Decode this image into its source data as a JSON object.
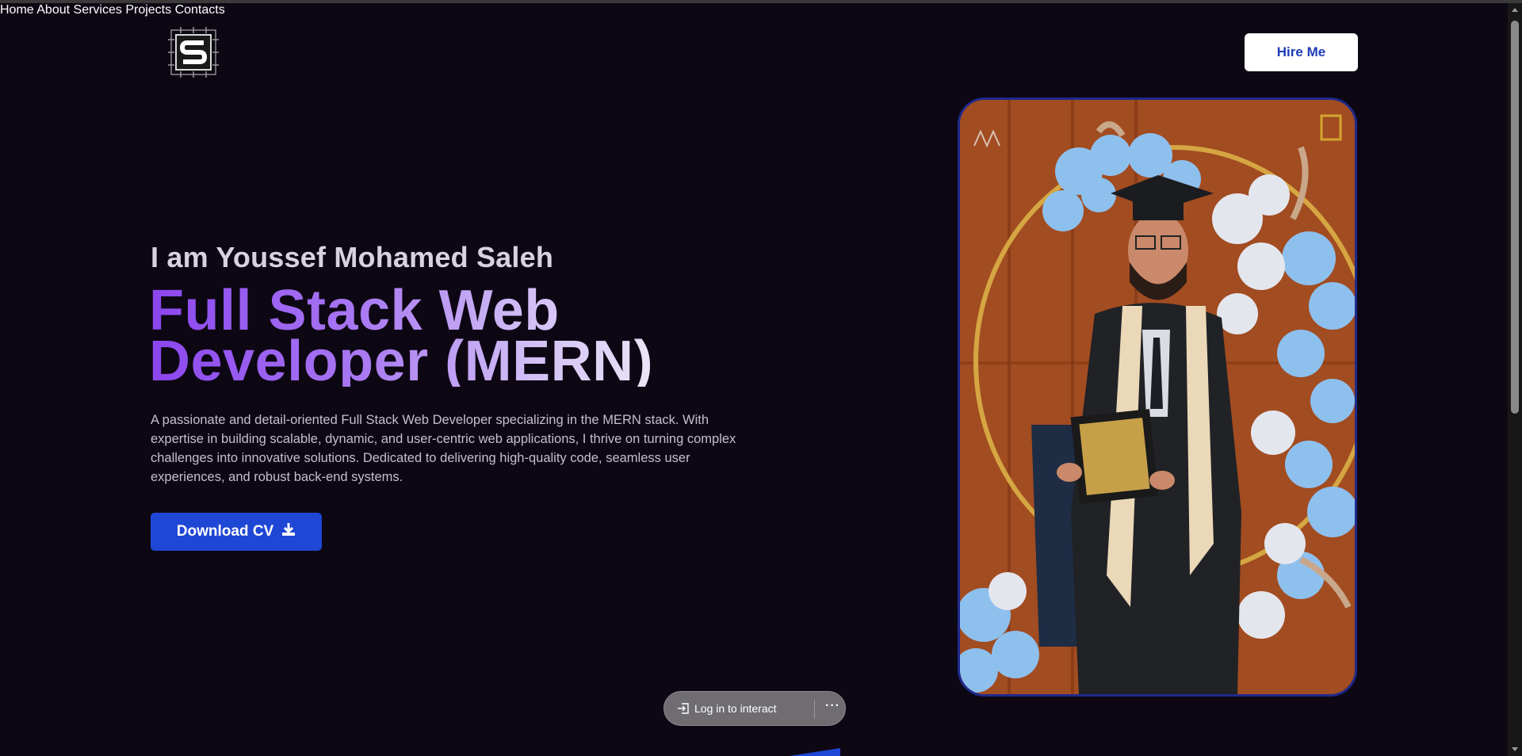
{
  "header": {
    "logo_name": "S-monogram-logo",
    "nav": [
      {
        "label": "Home"
      },
      {
        "label": "About"
      },
      {
        "label": "Services"
      },
      {
        "label": "Projects"
      },
      {
        "label": "Contacts"
      }
    ],
    "hire_label": "Hire Me"
  },
  "hero": {
    "intro": "I am Youssef Mohamed Saleh",
    "headline_line1": "Full Stack Web",
    "headline_line2": "Developer (MERN)",
    "description": "A passionate and detail-oriented Full Stack Web Developer specializing in the MERN stack. With expertise in building scalable, dynamic, and user-centric web applications, I thrive on turning complex challenges into innovative solutions. Dedicated to delivering high-quality code, seamless user experiences, and robust back-end systems.",
    "cv_label": "Download CV",
    "cv_icon": "download-icon"
  },
  "photo": {
    "subject": "graduate-portrait"
  },
  "overlay": {
    "login_label": "Log in to interact",
    "more_label": "···"
  },
  "colors": {
    "background": "#0d0714",
    "accent_blue": "#1f47d6",
    "headline_purple": "#8b45ee",
    "photo_border": "#1e2a8c"
  }
}
